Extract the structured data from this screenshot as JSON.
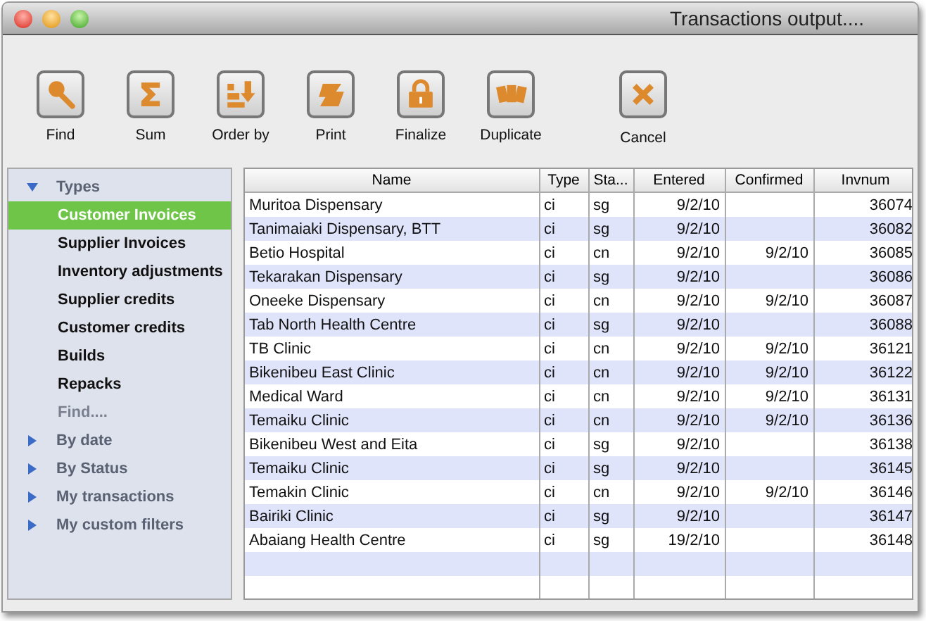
{
  "window": {
    "title": "Transactions output...."
  },
  "toolbar": [
    {
      "label": "Find"
    },
    {
      "label": "Sum"
    },
    {
      "label": "Order by"
    },
    {
      "label": "Print"
    },
    {
      "label": "Finalize"
    },
    {
      "label": "Duplicate"
    },
    {
      "label": "Cancel"
    }
  ],
  "sidebar": {
    "groups": [
      {
        "label": "Types",
        "expanded": true,
        "children": [
          {
            "label": "Customer Invoices",
            "selected": true,
            "kind": "item"
          },
          {
            "label": "Supplier Invoices",
            "selected": false,
            "kind": "item"
          },
          {
            "label": "Inventory adjustments",
            "selected": false,
            "kind": "item"
          },
          {
            "label": "Supplier credits",
            "selected": false,
            "kind": "item"
          },
          {
            "label": "Customer credits",
            "selected": false,
            "kind": "item"
          },
          {
            "label": "Builds",
            "selected": false,
            "kind": "item"
          },
          {
            "label": "Repacks",
            "selected": false,
            "kind": "item"
          },
          {
            "label": "Find....",
            "selected": false,
            "kind": "action"
          }
        ]
      },
      {
        "label": "By date",
        "expanded": false
      },
      {
        "label": "By Status",
        "expanded": false
      },
      {
        "label": "My transactions",
        "expanded": false
      },
      {
        "label": "My custom filters",
        "expanded": false
      }
    ]
  },
  "table": {
    "columns": [
      "Name",
      "Type",
      "Sta...",
      "Entered",
      "Confirmed",
      "Invnum"
    ],
    "rows": [
      [
        "Muritoa Dispensary",
        "ci",
        "sg",
        "9/2/10",
        "",
        "36074"
      ],
      [
        "Tanimaiaki Dispensary, BTT",
        "ci",
        "sg",
        "9/2/10",
        "",
        "36082"
      ],
      [
        "Betio Hospital",
        "ci",
        "cn",
        "9/2/10",
        "9/2/10",
        "36085"
      ],
      [
        "Tekarakan Dispensary",
        "ci",
        "sg",
        "9/2/10",
        "",
        "36086"
      ],
      [
        "Oneeke Dispensary",
        "ci",
        "cn",
        "9/2/10",
        "9/2/10",
        "36087"
      ],
      [
        "Tab North Health Centre",
        "ci",
        "sg",
        "9/2/10",
        "",
        "36088"
      ],
      [
        "TB Clinic",
        "ci",
        "cn",
        "9/2/10",
        "9/2/10",
        "36121"
      ],
      [
        "Bikenibeu East Clinic",
        "ci",
        "cn",
        "9/2/10",
        "9/2/10",
        "36122"
      ],
      [
        "Medical Ward",
        "ci",
        "cn",
        "9/2/10",
        "9/2/10",
        "36131"
      ],
      [
        "Temaiku Clinic",
        "ci",
        "cn",
        "9/2/10",
        "9/2/10",
        "36136"
      ],
      [
        "Bikenibeu West and Eita",
        "ci",
        "sg",
        "9/2/10",
        "",
        "36138"
      ],
      [
        "Temaiku Clinic",
        "ci",
        "sg",
        "9/2/10",
        "",
        "36145"
      ],
      [
        "Temakin Clinic",
        "ci",
        "cn",
        "9/2/10",
        "9/2/10",
        "36146"
      ],
      [
        "Bairiki Clinic",
        "ci",
        "sg",
        "9/2/10",
        "",
        "36147"
      ],
      [
        "Abaiang Health Centre",
        "ci",
        "sg",
        "19/2/10",
        "",
        "36148"
      ]
    ]
  }
}
